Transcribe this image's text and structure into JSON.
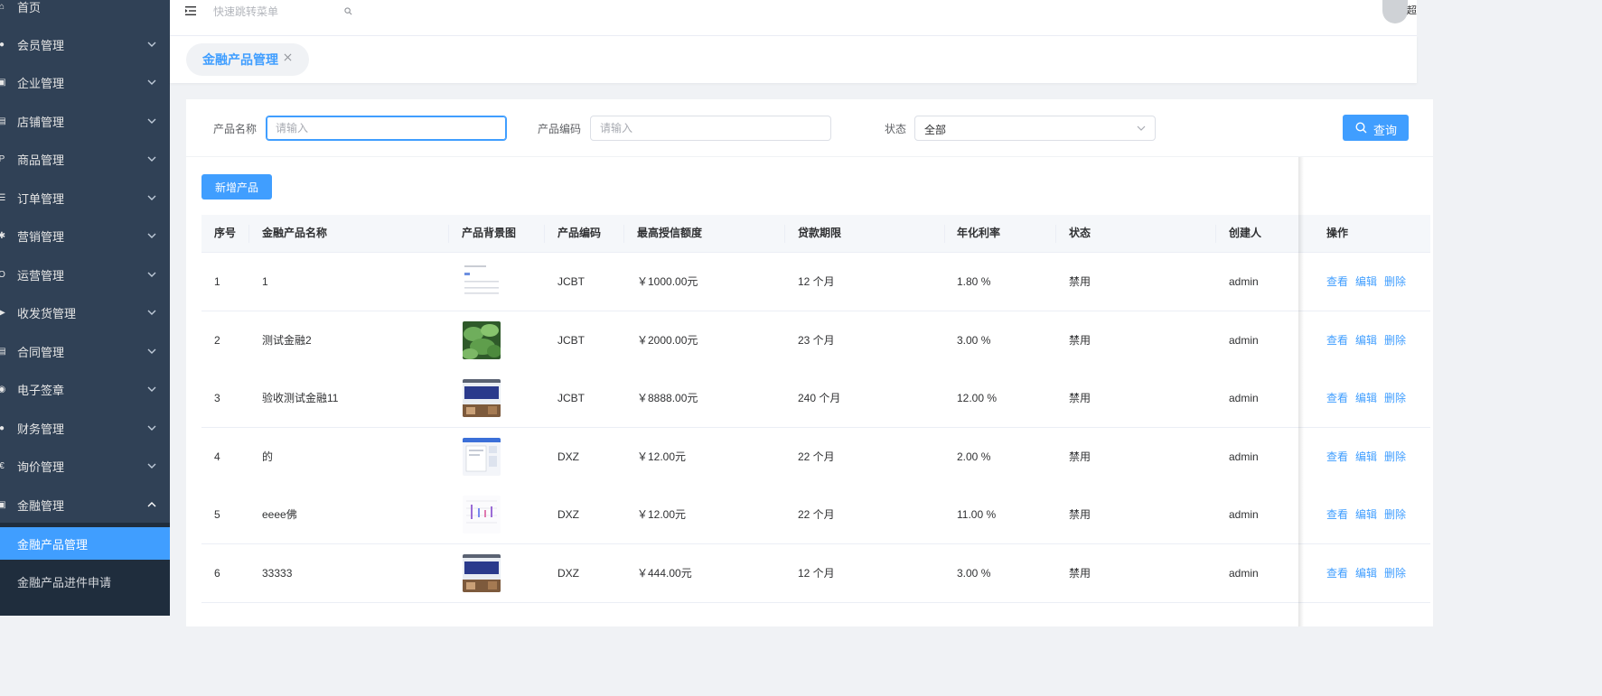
{
  "sidebar": {
    "items": [
      {
        "label": "首页",
        "icon": "home-icon",
        "expandable": false
      },
      {
        "label": "会员管理",
        "icon": "member-icon",
        "expandable": true
      },
      {
        "label": "企业管理",
        "icon": "enterprise-icon",
        "expandable": true
      },
      {
        "label": "店铺管理",
        "icon": "store-icon",
        "expandable": true
      },
      {
        "label": "商品管理",
        "icon": "product-icon",
        "expandable": true
      },
      {
        "label": "订单管理",
        "icon": "order-icon",
        "expandable": true
      },
      {
        "label": "营销管理",
        "icon": "marketing-icon",
        "expandable": true
      },
      {
        "label": "运营管理",
        "icon": "operation-icon",
        "expandable": true
      },
      {
        "label": "收发货管理",
        "icon": "shipping-icon",
        "expandable": true
      },
      {
        "label": "合同管理",
        "icon": "contract-icon",
        "expandable": true
      },
      {
        "label": "电子签章",
        "icon": "seal-icon",
        "expandable": true
      },
      {
        "label": "财务管理",
        "icon": "finance-icon",
        "expandable": true
      },
      {
        "label": "询价管理",
        "icon": "inquiry-icon",
        "expandable": true
      },
      {
        "label": "金融管理",
        "icon": "banking-icon",
        "expandable": true,
        "expanded": true
      }
    ],
    "submenu": [
      {
        "label": "金融产品管理",
        "active": true
      },
      {
        "label": "金融产品进件申请",
        "active": false
      }
    ]
  },
  "header": {
    "quick_placeholder": "快速跳转菜单",
    "user_initial": "超"
  },
  "tags": {
    "active_label": "金融产品管理"
  },
  "search": {
    "name_label": "产品名称",
    "name_placeholder": "请输入",
    "code_label": "产品编码",
    "code_placeholder": "请输入",
    "status_label": "状态",
    "status_value": "全部",
    "query_label": "查询"
  },
  "toolbar": {
    "add_label": "新增产品"
  },
  "table": {
    "columns": [
      "序号",
      "金融产品名称",
      "产品背景图",
      "产品编码",
      "最高授信额度",
      "贷款期限",
      "年化利率",
      "状态",
      "创建人",
      "操作"
    ],
    "actions": [
      "查看",
      "编辑",
      "删除"
    ],
    "rows": [
      {
        "index": "1",
        "name": "1",
        "thumb": "doc",
        "code": "JCBT",
        "limit": "￥1000.00元",
        "term": "12 个月",
        "rate": "1.80 %",
        "status": "禁用",
        "creator": "admin"
      },
      {
        "index": "2",
        "name": "测试金融2",
        "thumb": "leaf",
        "code": "JCBT",
        "limit": "￥2000.00元",
        "term": "23 个月",
        "rate": "3.00 %",
        "status": "禁用",
        "creator": "admin"
      },
      {
        "index": "3",
        "name": "验收测试金融11",
        "thumb": "sign",
        "code": "JCBT",
        "limit": "￥8888.00元",
        "term": "240 个月",
        "rate": "12.00 %",
        "status": "禁用",
        "creator": "admin"
      },
      {
        "index": "4",
        "name": "的",
        "thumb": "screen",
        "code": "DXZ",
        "limit": "￥12.00元",
        "term": "22 个月",
        "rate": "2.00 %",
        "status": "禁用",
        "creator": "admin"
      },
      {
        "index": "5",
        "name": "eeee佛",
        "thumb": "chart",
        "code": "DXZ",
        "limit": "￥12.00元",
        "term": "22 个月",
        "rate": "11.00 %",
        "status": "禁用",
        "creator": "admin"
      },
      {
        "index": "6",
        "name": "33333",
        "thumb": "sign",
        "code": "DXZ",
        "limit": "￥444.00元",
        "term": "12 个月",
        "rate": "3.00 %",
        "status": "禁用",
        "creator": "admin"
      }
    ]
  },
  "colors": {
    "sidebar_bg": "#304156",
    "submenu_bg": "#1f2d3d",
    "accent": "#409eff"
  }
}
